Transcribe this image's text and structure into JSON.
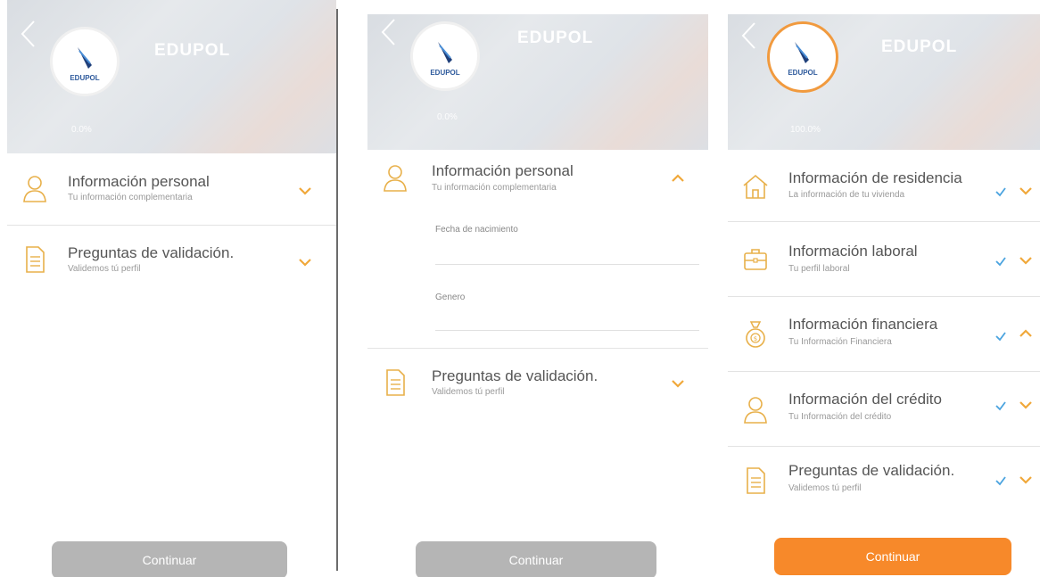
{
  "app": {
    "brand": "EDUPOL",
    "logo_text": "EDUPOL"
  },
  "screens": [
    {
      "progress": "0.0%",
      "items": [
        {
          "title": "Información personal",
          "subtitle": "Tu información complementaria",
          "icon": "user-icon",
          "expanded": false
        },
        {
          "title": "Preguntas de validación.",
          "subtitle": "Validemos tú perfil",
          "icon": "document-icon",
          "expanded": false
        }
      ],
      "button": {
        "label": "Continuar",
        "enabled": false
      }
    },
    {
      "progress": "0.0%",
      "items": [
        {
          "title": "Información personal",
          "subtitle": "Tu información complementaria",
          "icon": "user-icon",
          "expanded": true,
          "fields": [
            {
              "label": "Fecha de nacimiento",
              "value": ""
            },
            {
              "label": "Genero",
              "value": ""
            }
          ]
        },
        {
          "title": "Preguntas de validación.",
          "subtitle": "Validemos tú perfil",
          "icon": "document-icon",
          "expanded": false
        }
      ],
      "button": {
        "label": "Continuar",
        "enabled": false
      }
    },
    {
      "progress": "100.0%",
      "items": [
        {
          "title": "Información de residencia",
          "subtitle": "La información de tu vivienda",
          "icon": "house-icon",
          "completed": true,
          "expanded": false
        },
        {
          "title": "Información laboral",
          "subtitle": "Tu perfil laboral",
          "icon": "briefcase-icon",
          "completed": true,
          "expanded": false
        },
        {
          "title": "Información financiera",
          "subtitle": "Tu Información Financiera",
          "icon": "money-bag-icon",
          "completed": true,
          "expanded": true
        },
        {
          "title": "Información del crédito",
          "subtitle": "Tu Información del crédito",
          "icon": "user-icon",
          "completed": true,
          "expanded": false
        },
        {
          "title": "Preguntas de validación.",
          "subtitle": "Validemos tú perfil",
          "icon": "document-icon",
          "completed": true,
          "expanded": false
        }
      ],
      "button": {
        "label": "Continuar",
        "enabled": true
      }
    }
  ],
  "colors": {
    "accent": "#f7892a",
    "chevron": "#f0a83a",
    "check": "#4aa3df",
    "disabled": "#b5b5b5",
    "icon": "#e8b04a"
  }
}
